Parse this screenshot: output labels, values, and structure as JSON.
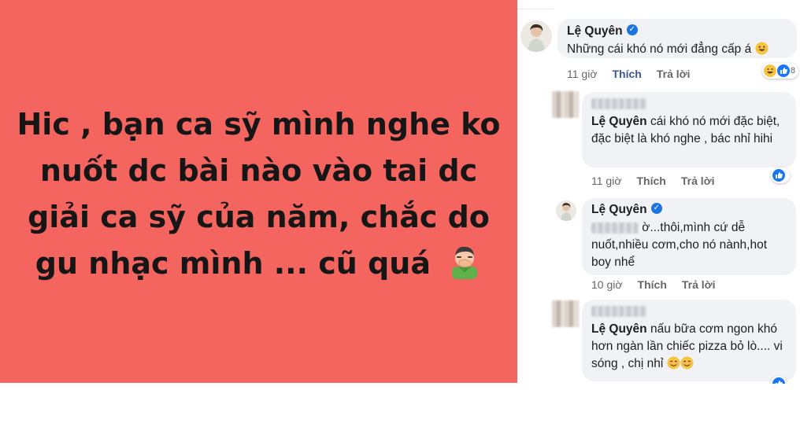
{
  "post": {
    "text": "Hic , bạn ca sỹ mình nghe ko nuốt dc bài nào vào tai dc giải ca sỹ của năm, chắc do gu nhạc mình ... cũ quá",
    "background": "#f4655f",
    "emoji": "face-with-hand-over-mouth-icon"
  },
  "comments": [
    {
      "author": "Lệ Quyên",
      "verified": true,
      "text": "Những cái khó nó mới đẳng cấp á",
      "emoji": "grinning-face-icon",
      "time": "11 giờ",
      "like_label": "Thích",
      "reply_label": "Trả lời",
      "reaction_count": "8"
    },
    {
      "mention": "Lệ Quyên",
      "text": " cái khó nó mới đặc biệt, đặc biệt là khó nghe , bác nhỉ hihi",
      "time": "11 giờ",
      "like_label": "Thích",
      "reply_label": "Trả lời"
    },
    {
      "author": "Lệ Quyên",
      "verified": true,
      "text": " ờ...thôi,mình cứ dễ nuốt,nhiều cơm,cho nó nành,hot boy nhể",
      "time": "10 giờ",
      "like_label": "Thích",
      "reply_label": "Trả lời"
    },
    {
      "mention": "Lệ Quyên",
      "text": " nấu bữa cơm ngon khó hơn ngàn lần chiếc pizza bỏ lò.... vi sóng , chị nhỉ",
      "emoji": "smiling-face-icon"
    }
  ]
}
